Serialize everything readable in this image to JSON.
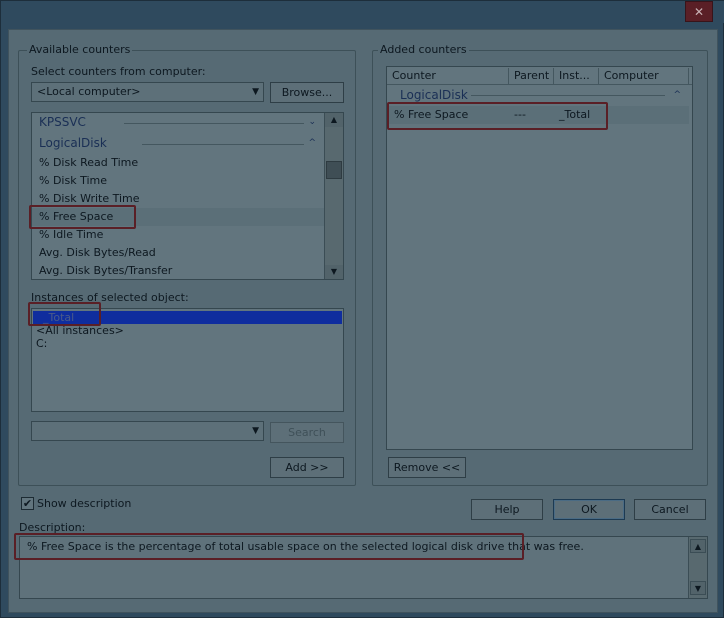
{
  "window": {
    "close_glyph": "✕"
  },
  "available": {
    "legend": "Available counters",
    "select_label": "Select counters from computer:",
    "computer_value": "<Local computer>",
    "browse_label": "Browse...",
    "objects": [
      {
        "label": "KPSSVC",
        "chevron": "⌄"
      },
      {
        "label": "LogicalDisk",
        "chevron": "^"
      }
    ],
    "counters": [
      "% Disk Read Time",
      "% Disk Time",
      "% Disk Write Time",
      "% Free Space",
      "% Idle Time",
      "Avg. Disk Bytes/Read",
      "Avg. Disk Bytes/Transfer"
    ],
    "instances_label": "Instances of selected object:",
    "instances": [
      "_Total",
      "<All instances>",
      "C:"
    ],
    "search_label": "Search",
    "add_label": "Add >>"
  },
  "added": {
    "legend": "Added counters",
    "columns": [
      "Counter",
      "Parent",
      "Inst...",
      "Computer"
    ],
    "group": "LogicalDisk",
    "group_chevron": "^",
    "rows": [
      {
        "counter": "% Free Space",
        "parent": "---",
        "instance": "_Total",
        "computer": ""
      }
    ],
    "remove_label": "Remove <<"
  },
  "show_description": {
    "label": "Show description",
    "checked": true,
    "glyph": "✔"
  },
  "buttons": {
    "help": "Help",
    "ok": "OK",
    "cancel": "Cancel"
  },
  "description": {
    "label": "Description:",
    "text": "% Free Space is the percentage of total usable space on the selected logical disk drive that was free."
  },
  "colors": {
    "dim_background": "#566a74",
    "highlight_box": "#5a1f26",
    "selection": "#0f2d9e",
    "object_text": "#1a2f55"
  }
}
